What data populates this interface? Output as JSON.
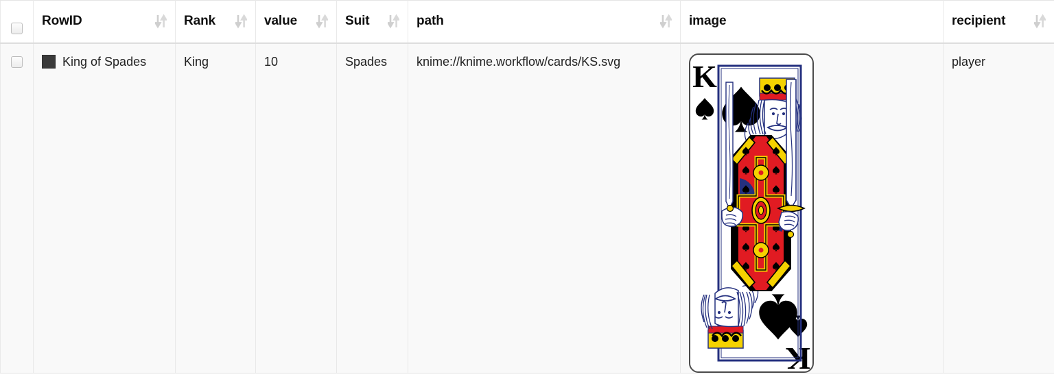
{
  "table": {
    "columns": [
      {
        "key": "select",
        "label": "",
        "sortable": false,
        "icon": "checkbox-icon"
      },
      {
        "key": "rowid",
        "label": "RowID",
        "sortable": true,
        "icon": "sort-icon"
      },
      {
        "key": "rank",
        "label": "Rank",
        "sortable": true,
        "icon": "sort-icon"
      },
      {
        "key": "value",
        "label": "value",
        "sortable": true,
        "icon": "sort-icon"
      },
      {
        "key": "suit",
        "label": "Suit",
        "sortable": true,
        "icon": "sort-icon"
      },
      {
        "key": "path",
        "label": "path",
        "sortable": true,
        "icon": "sort-icon"
      },
      {
        "key": "image",
        "label": "image",
        "sortable": false,
        "icon": ""
      },
      {
        "key": "recipient",
        "label": "recipient",
        "sortable": true,
        "icon": "sort-icon"
      }
    ],
    "rows": [
      {
        "selected": false,
        "rowid": "King of Spades",
        "rowid_swatch": "#3a3a3a",
        "rank": "King",
        "value": "10",
        "suit": "Spades",
        "path": "knime://knime.workflow/cards/KS.svg",
        "image": {
          "alt": "King of Spades playing card",
          "corner_rank": "K",
          "corner_suit": "♠",
          "suit_name": "spade"
        },
        "recipient": "player"
      }
    ]
  },
  "colors": {
    "card_red": "#e11b22",
    "card_yellow": "#f5d200",
    "card_blue": "#24307f",
    "card_black": "#000000",
    "header_text": "#0f0f0f",
    "cell_text": "#222222",
    "row_background": "#f9f9f9",
    "grid_line": "#e9e9e9",
    "sort_icon": "#cfcfcf"
  }
}
